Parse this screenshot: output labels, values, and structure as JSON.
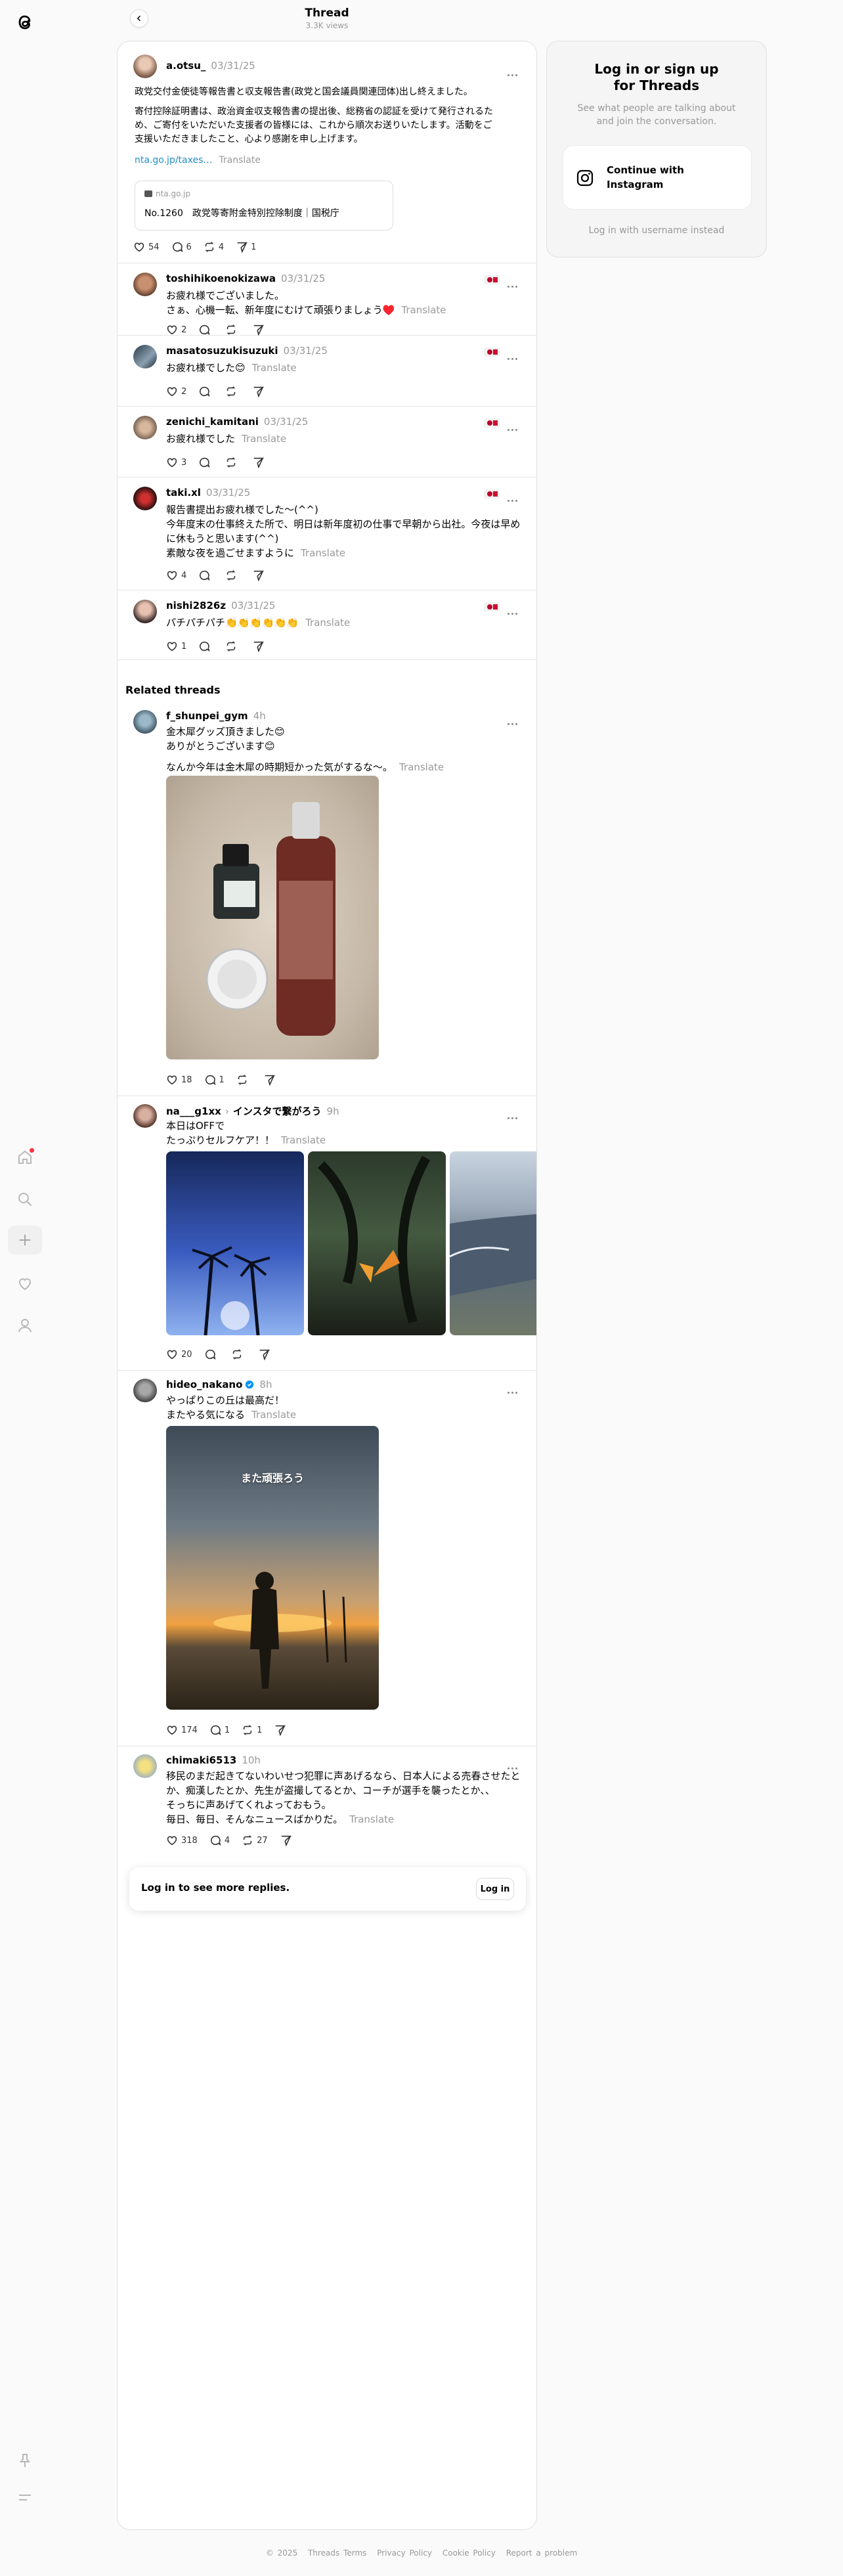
{
  "header": {
    "title": "Thread",
    "views": "3.3K views"
  },
  "main_post": {
    "username": "a.otsu_",
    "time": "03/31/25",
    "lines": [
      "政党交付金使徒等報告書と収支報告書(政党と国会議員関連団体)出し終えました。",
      "寄付控除証明書は、政治資金収支報告書の提出後、総務省の認証を受けて発行されるた",
      "め、ご寄付をいただいた支援者の皆様には、これから順次お送りいたします。活動をご",
      "支援いただきましたこと、心より感謝を申し上げます。"
    ],
    "link_text": "nta.go.jp/taxes…",
    "translate": "Translate",
    "card_domain": "nta.go.jp",
    "card_title": "No.1260　政党等寄附金特別控除制度｜国税庁",
    "likes": "54",
    "replies": "6",
    "reposts": "4",
    "shares": "1"
  },
  "replies": [
    {
      "username": "toshihikoenokizawa",
      "time": "03/31/25",
      "lines": [
        "お疲れ様でございました。",
        "さぁ、心機一転、新年度にむけて頑張りましょう♥️"
      ],
      "translate": "Translate",
      "likes": "2",
      "replies": "",
      "reposts": "",
      "shares": ""
    },
    {
      "username": "masatosuzukisuzuki",
      "time": "03/31/25",
      "lines": [
        "お疲れ様でした😊"
      ],
      "translate": "Translate",
      "likes": "2",
      "replies": "",
      "reposts": "",
      "shares": ""
    },
    {
      "username": "zenichi_kamitani",
      "time": "03/31/25",
      "lines": [
        "お疲れ様でした"
      ],
      "translate": "Translate",
      "likes": "3",
      "replies": "",
      "reposts": "",
      "shares": ""
    },
    {
      "username": "taki.xl",
      "time": "03/31/25",
      "lines": [
        "報告書提出お疲れ様でした〜(^^)",
        "今年度末の仕事終えた所で、明日は新年度初の仕事で早朝から出社。今夜は早め",
        "に休もうと思います(^^)",
        "素敵な夜を過ごせますように"
      ],
      "translate": "Translate",
      "likes": "4",
      "replies": "",
      "reposts": "",
      "shares": ""
    },
    {
      "username": "nishi2826z",
      "time": "03/31/25",
      "lines": [
        "パチパチパチ👏👏👏👏👏👏"
      ],
      "translate": "Translate",
      "likes": "1",
      "replies": "",
      "reposts": "",
      "shares": ""
    }
  ],
  "related_title": "Related threads",
  "related": [
    {
      "username": "f_shunpei_gym",
      "time": "4h",
      "lines": [
        "金木犀グッズ頂きました😊",
        "ありがとうございます😊",
        "",
        "なんか今年は金木犀の時期短かった気がするな〜。"
      ],
      "translate": "Translate",
      "likes": "18",
      "replies": "1",
      "reposts": "",
      "shares": ""
    },
    {
      "username": "na___g1xx",
      "topic": "インスタで繋がろう",
      "time": "9h",
      "lines": [
        "本日はOFFで",
        "たっぷりセルフケア！！"
      ],
      "translate": "Translate",
      "likes": "20",
      "replies": "",
      "reposts": "",
      "shares": ""
    },
    {
      "username": "hideo_nakano",
      "time": "8h",
      "lines": [
        "やっぱりこの丘は最高だ！",
        "またやる気になる"
      ],
      "translate": "Translate",
      "photo_caption": "また頑張ろう",
      "likes": "174",
      "replies": "1",
      "reposts": "1",
      "shares": ""
    },
    {
      "username": "chimaki6513",
      "time": "10h",
      "lines": [
        "移民のまだ起きてないわいせつ犯罪に声あげるなら、日本人による売春させたと",
        "か、痴漢したとか、先生が盗撮してるとか、コーチが選手を襲ったとか、、",
        "そっちに声あげてくれよっておもう。",
        "毎日、毎日、そんなニュースばかりだ。"
      ],
      "translate": "Translate",
      "likes": "318",
      "replies": "4",
      "reposts": "27",
      "shares": ""
    }
  ],
  "login_bar": {
    "text": "Log in to see more replies.",
    "button": "Log in"
  },
  "side_panel": {
    "title_line1": "Log in or sign up",
    "title_line2": "for Threads",
    "subtitle_line1": "See what people are talking about",
    "subtitle_line2": "and join the conversation.",
    "button_line1": "Continue with",
    "button_line2": "Instagram",
    "alt": "Log in with username instead"
  },
  "footer": [
    "© 2025",
    "Threads Terms",
    "Privacy Policy",
    "Cookie Policy",
    "Report a problem"
  ],
  "colors": {
    "link": "#1f8ec7",
    "verified": "#0095f6",
    "notification_dot": "#ff3040"
  }
}
